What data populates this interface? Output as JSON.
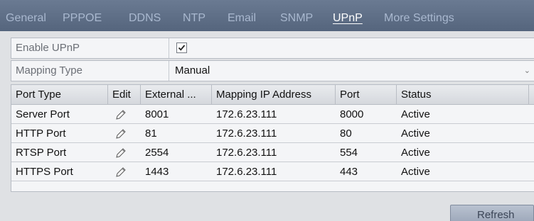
{
  "tabs": [
    {
      "label": "General",
      "active": false
    },
    {
      "label": "PPPOE",
      "active": false
    },
    {
      "label": "DDNS",
      "active": false
    },
    {
      "label": "NTP",
      "active": false
    },
    {
      "label": "Email",
      "active": false
    },
    {
      "label": "SNMP",
      "active": false
    },
    {
      "label": "UPnP",
      "active": true
    },
    {
      "label": "More Settings",
      "active": false
    }
  ],
  "form": {
    "enable_upnp_label": "Enable UPnP",
    "enable_upnp_checked": true,
    "mapping_type_label": "Mapping Type",
    "mapping_type_value": "Manual"
  },
  "table": {
    "columns": [
      "Port Type",
      "Edit",
      "External ...",
      "Mapping IP Address",
      "Port",
      "Status"
    ],
    "rows": [
      {
        "port_type": "Server Port",
        "external": "8001",
        "ip": "172.6.23.111",
        "port": "8000",
        "status": "Active"
      },
      {
        "port_type": "HTTP Port",
        "external": "81",
        "ip": "172.6.23.111",
        "port": "80",
        "status": "Active"
      },
      {
        "port_type": "RTSP Port",
        "external": "2554",
        "ip": "172.6.23.111",
        "port": "554",
        "status": "Active"
      },
      {
        "port_type": "HTTPS Port",
        "external": "1443",
        "ip": "172.6.23.111",
        "port": "443",
        "status": "Active"
      }
    ]
  },
  "buttons": {
    "refresh_label": "Refresh"
  },
  "colors": {
    "tab_bar": "#5f6f87",
    "tab_active": "#ffffff",
    "tab_inactive": "#a9b8cf",
    "panel_bg": "#dfe1e4",
    "refresh_button": "#a9b3c3"
  },
  "icons": {
    "edit": "pencil-edit-icon",
    "checkbox": "checkmark-icon",
    "dropdown": "chevron-down-icon"
  }
}
